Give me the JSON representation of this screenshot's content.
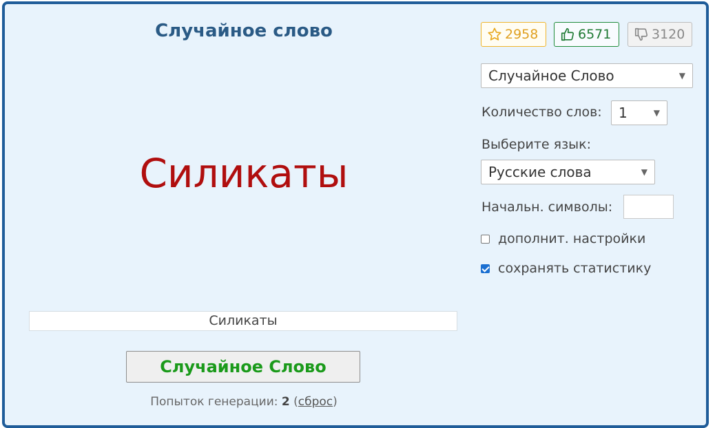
{
  "main": {
    "title": "Случайное слово",
    "generated_word": "Силикаты",
    "word_field_value": "Силикаты",
    "generate_button_label": "Случайное Слово",
    "attempts": {
      "label": "Попыток генерации: ",
      "count": "2",
      "reset_label": "сброс"
    }
  },
  "counters": {
    "favorites": "2958",
    "likes": "6571",
    "dislikes": "3120"
  },
  "settings": {
    "generator_type": "Случайное Слово",
    "count_label": "Количество слов:",
    "count_value": "1",
    "language_label": "Выберите язык:",
    "language_value": "Русские слова",
    "start_chars_label": "Начальн. символы:",
    "start_chars_value": "",
    "advanced_label": "дополнит. настройки",
    "save_stats_label": "сохранять статистику"
  },
  "icons": {
    "favorite": "star-icon",
    "like": "thumbs-up-icon",
    "dislike": "thumbs-down-icon",
    "dropdown": "chevron-down-icon"
  },
  "colors": {
    "border": "#1f5c99",
    "background": "#e8f3fc",
    "title": "#2a5a85",
    "word": "#b00e0e",
    "button_text": "#1a9a1a"
  }
}
